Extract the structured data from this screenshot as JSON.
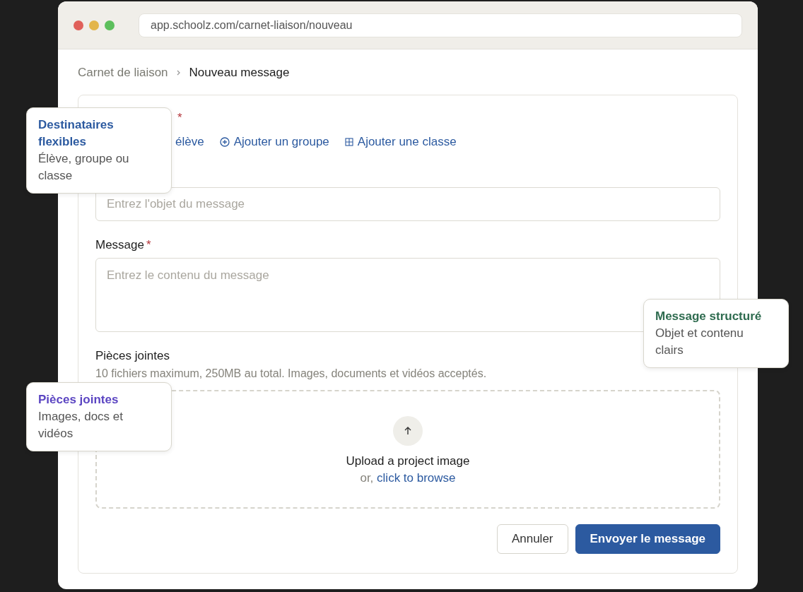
{
  "browser": {
    "url": "app.schoolz.com/carnet-liaison/nouveau"
  },
  "breadcrumb": [
    {
      "label": "Carnet de liaison",
      "current": false
    },
    {
      "label": "Nouveau message",
      "current": true
    }
  ],
  "recipients": {
    "required_mark": "*",
    "links": [
      {
        "label": "élève",
        "kind": "plain"
      },
      {
        "label": "Ajouter un groupe",
        "kind": "group"
      },
      {
        "label": "Ajouter une classe",
        "kind": "class"
      }
    ]
  },
  "subject": {
    "placeholder": "Entrez l'objet du message"
  },
  "message": {
    "label": "Message",
    "required_mark": "*",
    "placeholder": "Entrez le contenu du message"
  },
  "attachments": {
    "label": "Pièces jointes",
    "hint": "10 fichiers maximum, 250MB au total. Images, documents et vidéos acceptés.",
    "upload_title": "Upload a project image",
    "upload_prefix": "or,",
    "upload_link": "click to browse"
  },
  "buttons": [
    {
      "label": "Annuler",
      "kind": "secondary"
    },
    {
      "label": "Envoyer le message",
      "kind": "primary"
    }
  ],
  "callouts": [
    {
      "title": "Destinataires flexibles",
      "text": "Élève, groupe ou classe",
      "color": "#2c5aa0"
    },
    {
      "title": "Message structuré",
      "text": "Objet et contenu clairs",
      "color": "#2e6b4f"
    },
    {
      "title": "Pièces jointes",
      "text": "Images, docs et vidéos",
      "color": "#5b45c2"
    }
  ]
}
